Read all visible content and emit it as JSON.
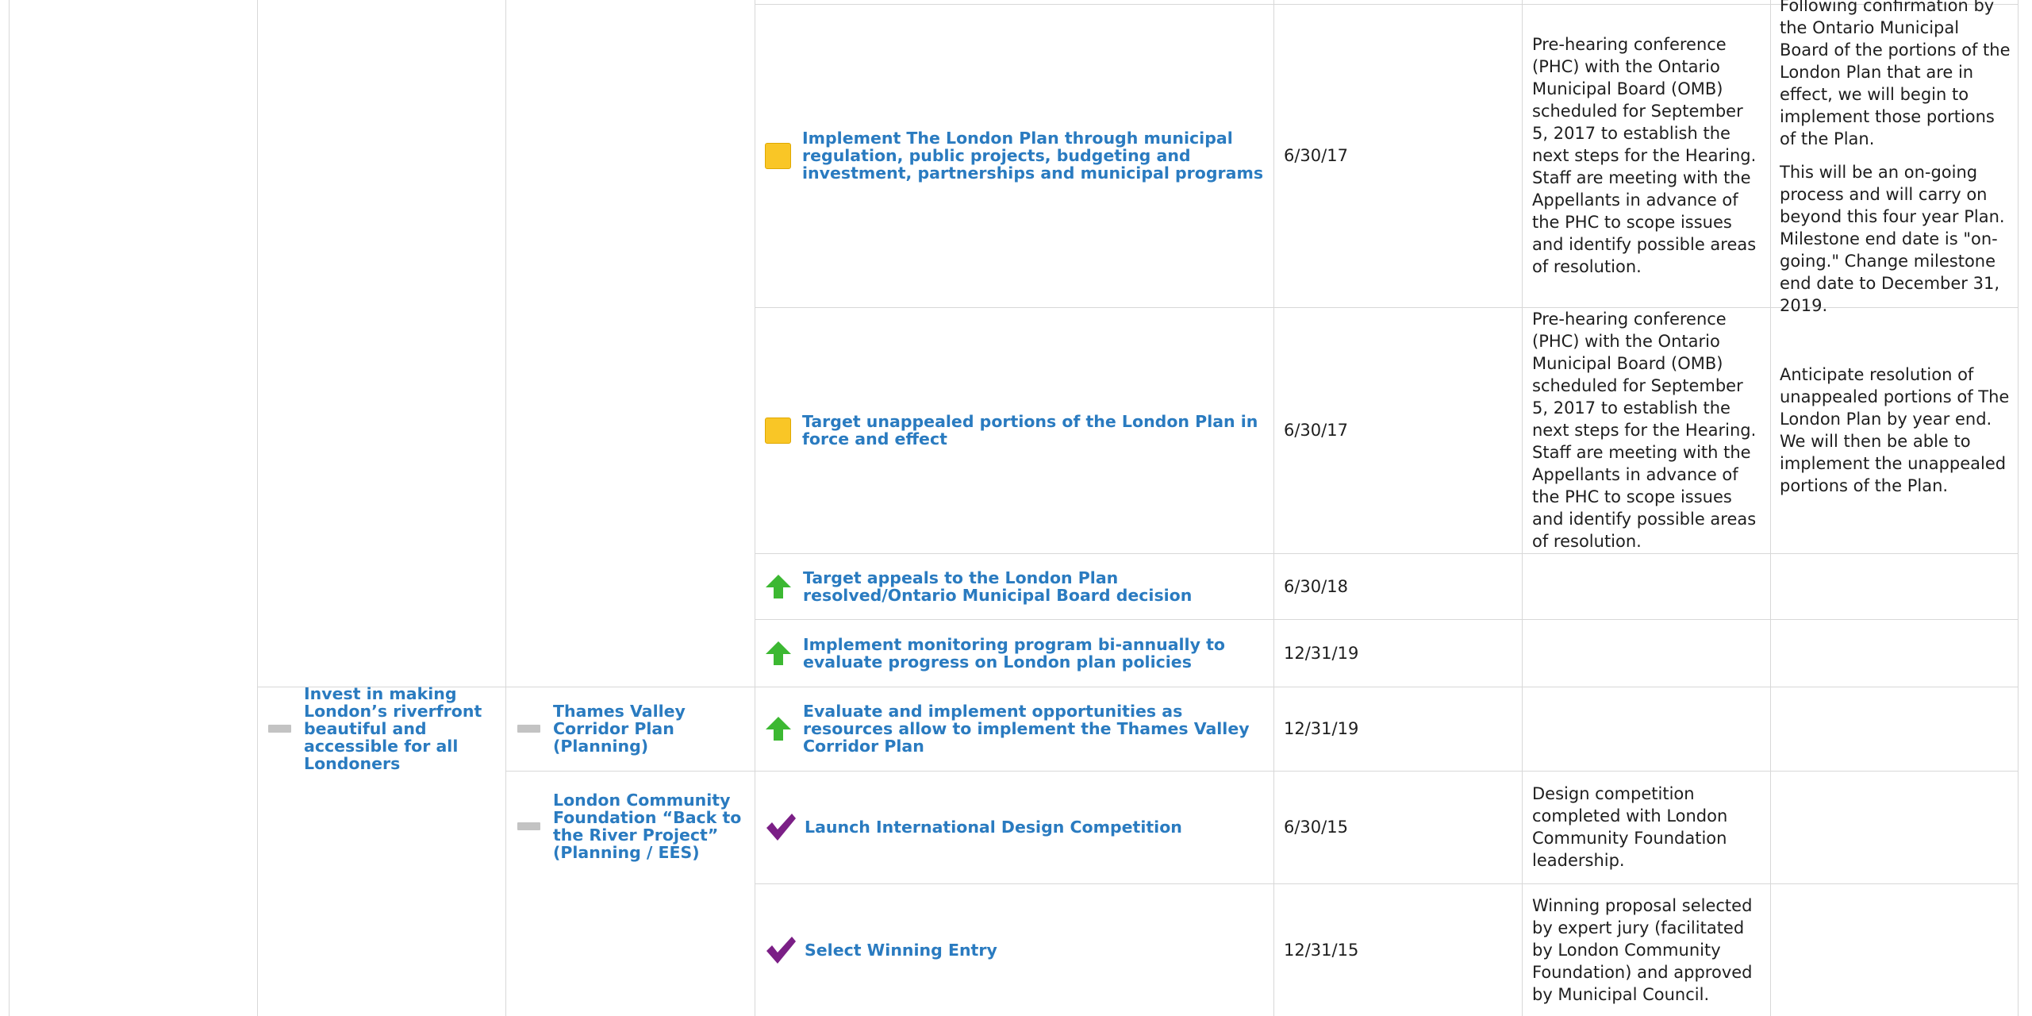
{
  "colors": {
    "link": "#2a7bc0",
    "status_caution": "#f9c626",
    "status_up": "#3cb832",
    "status_done": "#7b1f86",
    "status_neutral": "#c3c3c3"
  },
  "strategies": [
    {
      "label": "Invest in making London’s riverfront beautiful and accessible for all Londoners",
      "status_icon": "grey-dash-icon"
    }
  ],
  "initiatives": [
    {
      "label": "Thames Valley Corridor Plan (Planning)",
      "status_icon": "grey-dash-icon"
    },
    {
      "label": "London Community Foundation “Back to the River Project” (Planning / EES)",
      "status_icon": "grey-dash-icon"
    }
  ],
  "milestones": [
    {
      "label": "Implement The London Plan through municipal regulation, public projects, budgeting and investment, partnerships and municipal programs",
      "status_icon": "yellow-square-icon",
      "date": "6/30/17",
      "progress": "Pre-hearing conference (PHC) with the Ontario Municipal Board (OMB) scheduled for September 5, 2017 to establish the next steps for the Hearing. Staff are meeting with the Appellants in advance of the PHC to scope issues and identify possible areas of resolution.",
      "notes": [
        "Following confirmation by the Ontario Municipal Board of the portions of the London Plan that are in effect, we will begin to implement those portions of the Plan.",
        "This will be an on-going process and will carry on beyond this four year Plan. Milestone end date is \"on-going.\" Change milestone end date to December 31, 2019."
      ]
    },
    {
      "label": "Target unappealed portions of the London Plan in force and effect",
      "status_icon": "yellow-square-icon",
      "date": "6/30/17",
      "progress": "Pre-hearing conference (PHC) with the Ontario Municipal Board (OMB) scheduled for September 5, 2017 to establish the next steps for the Hearing. Staff are meeting with the Appellants in advance of the PHC to scope issues and identify possible areas of resolution.",
      "notes": [
        "Anticipate resolution of unappealed portions of The London Plan by year end. We will then be able to implement the unappealed portions of the Plan."
      ]
    },
    {
      "label": "Target appeals to the London Plan resolved/Ontario Municipal Board decision",
      "status_icon": "green-up-arrow-icon",
      "date": "6/30/18",
      "progress": "",
      "notes": []
    },
    {
      "label": "Implement monitoring program bi-annually to evaluate progress on London plan policies",
      "status_icon": "green-up-arrow-icon",
      "date": "12/31/19",
      "progress": "",
      "notes": []
    },
    {
      "label": "Evaluate and implement opportunities as resources allow to implement the Thames Valley Corridor Plan",
      "status_icon": "green-up-arrow-icon",
      "date": "12/31/19",
      "progress": "",
      "notes": []
    },
    {
      "label": "Launch International Design Competition",
      "status_icon": "purple-checkmark-icon",
      "date": "6/30/15",
      "progress": "Design competition completed with London Community Foundation leadership.",
      "notes": []
    },
    {
      "label": "Select Winning Entry",
      "status_icon": "purple-checkmark-icon",
      "date": "12/31/15",
      "progress": "Winning proposal selected by expert jury (facilitated by London Community Foundation) and approved by Municipal Council.",
      "notes": []
    }
  ]
}
